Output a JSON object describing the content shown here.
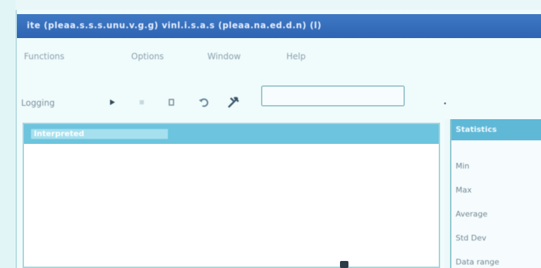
{
  "window": {
    "title": "ite  (pleaa.s.s.s.unu.v.g.g)  vinl.i.s.a.s  (pleaa.na.ed.d.n)  (l)"
  },
  "menubar": {
    "items": [
      "Functions",
      "Options",
      "Window",
      "Help"
    ]
  },
  "toolbar": {
    "logging_label": "Logging",
    "icons": [
      "play-icon",
      "stop-icon",
      "clear-icon",
      "undo-icon",
      "tools-icon"
    ],
    "search_value": ""
  },
  "list": {
    "header_label": "Interpreted"
  },
  "stats": {
    "header_label": "Statistics",
    "rows": [
      "Min",
      "Max",
      "Average",
      "Std Dev",
      "Data range"
    ]
  },
  "colors": {
    "titlebar": "#3070b8",
    "list_header": "#6cc4de",
    "stats_header": "#5fb8d6"
  }
}
